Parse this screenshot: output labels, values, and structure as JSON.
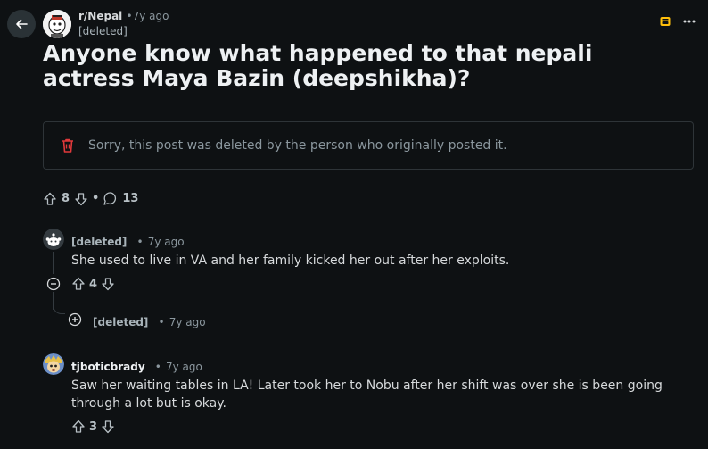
{
  "post": {
    "subreddit": "r/Nepal",
    "time": "7y ago",
    "author": "[deleted]",
    "title": "Anyone know what happened to that nepali actress Maya Bazin (deepshikha)?",
    "deleted_notice": "Sorry, this post was deleted by the person who originally posted it.",
    "votes": "8",
    "comments": "13",
    "separator": "•"
  },
  "icons": {
    "back": "back-arrow-icon",
    "save": "save-box-icon",
    "more": "more-options-icon",
    "trash": "trash-icon",
    "upvote": "upvote-icon",
    "downvote": "downvote-icon",
    "comment": "comment-bubble-icon",
    "collapse": "collapse-minus-icon",
    "expand": "expand-plus-icon"
  },
  "comments": [
    {
      "author": "[deleted]",
      "time": "7y ago",
      "body": "She used to live in VA and her family kicked her out after her exploits.",
      "votes": "4",
      "replies": [
        {
          "author": "[deleted]",
          "time": "7y ago"
        }
      ]
    },
    {
      "author": "tjboticbrady",
      "time": "7y ago",
      "body": "Saw her waiting tables in LA! Later took her to Nobu after her shift was over she is been going through a lot but is okay.",
      "votes": "3"
    }
  ],
  "colors": {
    "background": "#0e1113",
    "accent_save": "#ffbf0b",
    "trash": "#e0393b"
  }
}
